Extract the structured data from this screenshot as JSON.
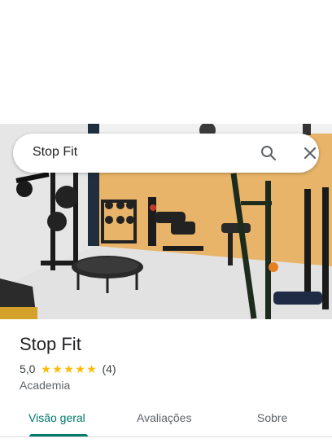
{
  "search": {
    "query": "Stop Fit"
  },
  "place": {
    "name": "Stop Fit",
    "rating": "5,0",
    "review_count": "(4)",
    "category": "Academia",
    "stars": [
      "★",
      "★",
      "★",
      "★",
      "★"
    ]
  },
  "tabs": [
    {
      "label": "Visão geral",
      "active": true
    },
    {
      "label": "Avaliações",
      "active": false
    },
    {
      "label": "Sobre",
      "active": false
    }
  ],
  "colors": {
    "accent": "#00796b",
    "star": "#fbbc04",
    "wall_left": "#e8e8e8",
    "wall_right": "#e9b466",
    "floor": "#e4e4e4"
  }
}
